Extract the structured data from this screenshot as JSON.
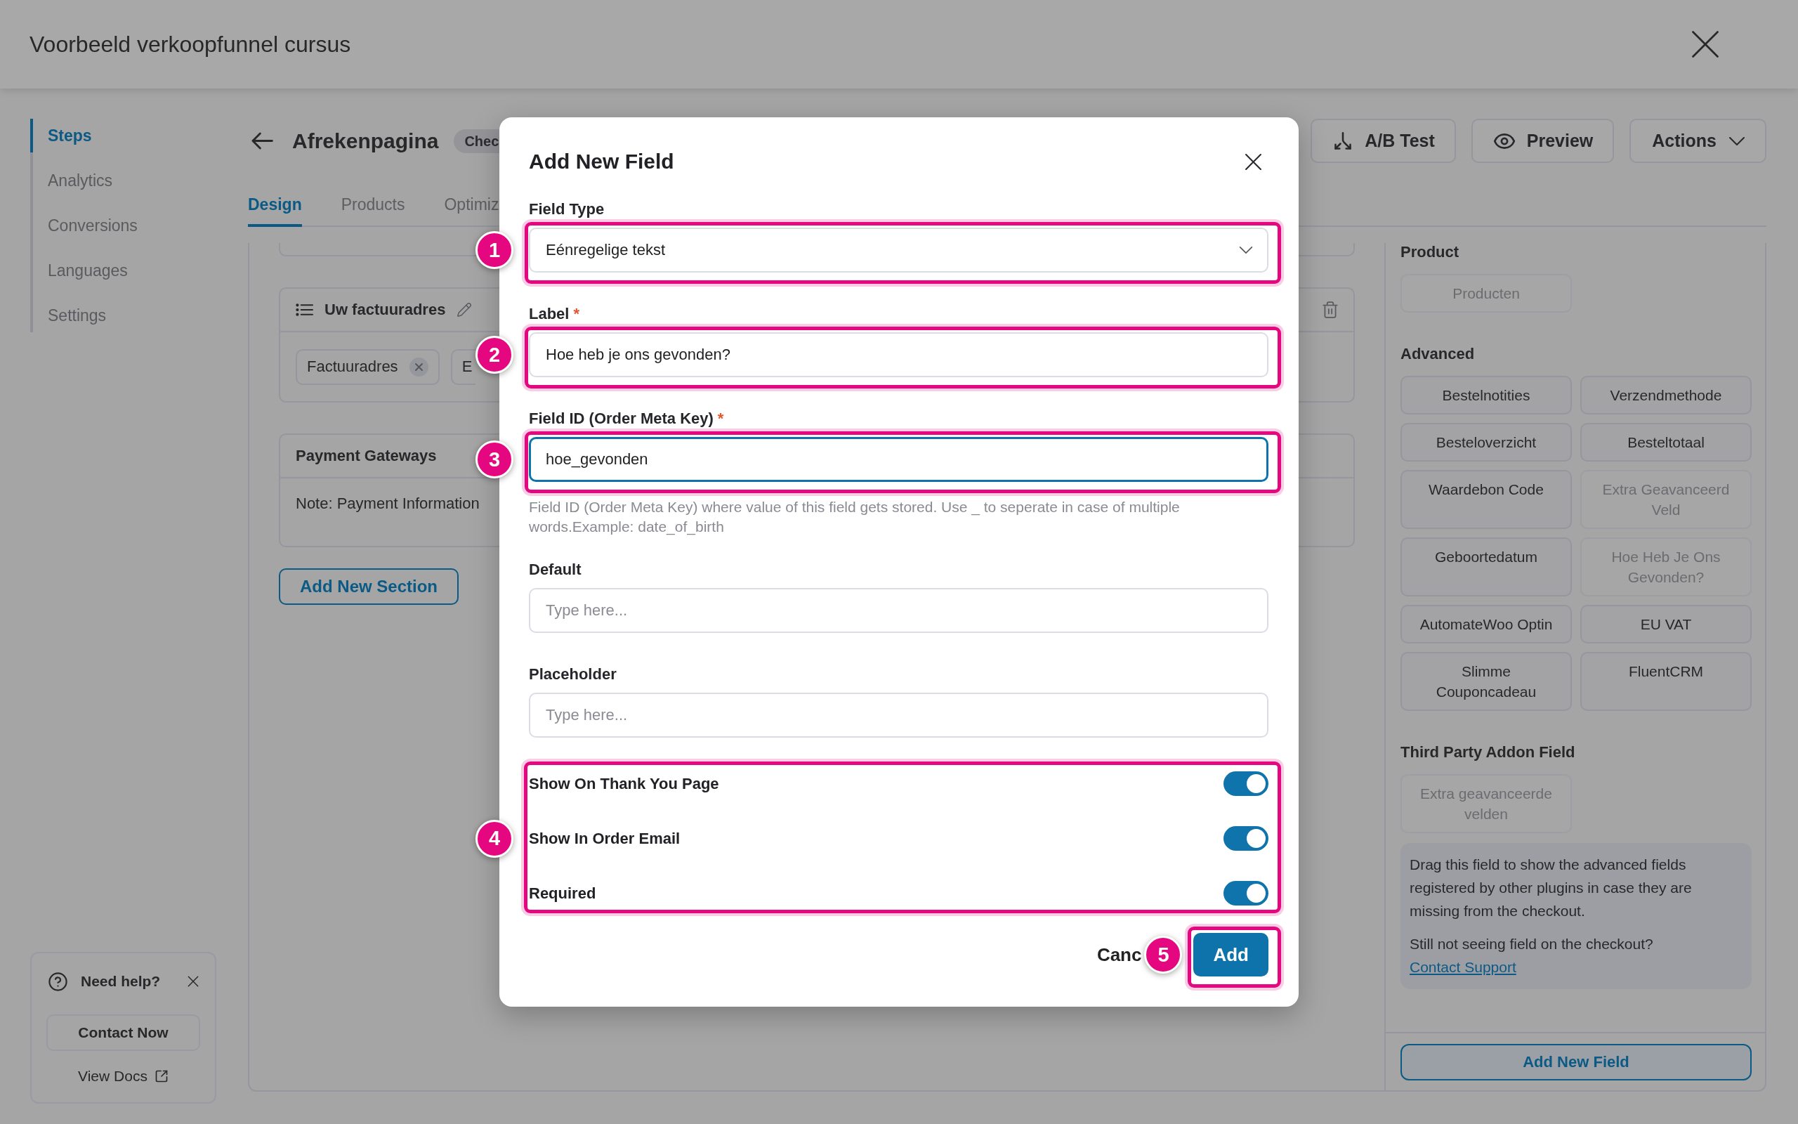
{
  "header": {
    "title": "Voorbeeld verkoopfunnel cursus"
  },
  "sidebar": {
    "items": [
      {
        "label": "Steps",
        "selected": true
      },
      {
        "label": "Analytics",
        "selected": false
      },
      {
        "label": "Conversions",
        "selected": false
      },
      {
        "label": "Languages",
        "selected": false
      },
      {
        "label": "Settings",
        "selected": false
      }
    ],
    "help": {
      "title": "Need help?",
      "button": "Contact Now",
      "link": "View Docs"
    }
  },
  "page_header": {
    "title": "Afrekenpagina",
    "badge": "Chec",
    "buttons": [
      {
        "label": "A/B Test",
        "kind": "split"
      },
      {
        "label": "Preview",
        "kind": "preview"
      },
      {
        "label": "Actions",
        "kind": "menu"
      }
    ]
  },
  "tabs": [
    {
      "label": "Design",
      "selected": true
    },
    {
      "label": "Products",
      "selected": false
    },
    {
      "label": "Optimiz",
      "selected": false
    }
  ],
  "canvas": {
    "sections": [
      {
        "kind": "fields",
        "title": "Uw factuuradres",
        "chips": [
          {
            "label": "Factuuradres",
            "removable": true
          },
          {
            "label": "E",
            "removable": false
          }
        ]
      },
      {
        "kind": "note",
        "title": "Payment Gateways",
        "note": "Note: Payment Information"
      }
    ],
    "add_button": "Add New Section"
  },
  "field_panel": {
    "groups": [
      {
        "title": "Product",
        "items": [
          {
            "label": "Producten",
            "disabled": true
          }
        ]
      },
      {
        "title": "Advanced",
        "items": [
          {
            "label": "Bestelnotities",
            "disabled": false
          },
          {
            "label": "Verzendmethode",
            "disabled": false
          },
          {
            "label": "Besteloverzicht",
            "disabled": false
          },
          {
            "label": "Besteltotaal",
            "disabled": false
          },
          {
            "label": "Waardebon Code",
            "disabled": false
          },
          {
            "label": "Extra Geavanceerd Veld",
            "disabled": true
          },
          {
            "label": "Geboortedatum",
            "disabled": false
          },
          {
            "label": "Hoe Heb Je Ons Gevonden?",
            "disabled": true
          },
          {
            "label": "AutomateWoo Optin",
            "disabled": false
          },
          {
            "label": "EU VAT",
            "disabled": false
          },
          {
            "label": "Slimme Couponcadeau",
            "disabled": false
          },
          {
            "label": "FluentCRM",
            "disabled": false
          }
        ]
      },
      {
        "title": "Third Party Addon Field",
        "items": [
          {
            "label": "Extra geavanceerde velden",
            "disabled": true
          }
        ]
      }
    ],
    "info": {
      "text": "Drag this field to show the advanced fields registered by other plugins in case they are missing from the checkout.",
      "question": "Still not seeing field on the checkout?",
      "link": "Contact Support"
    },
    "add_button": "Add New Field"
  },
  "modal": {
    "title": "Add New Field",
    "fields": [
      {
        "kind": "select",
        "label": "Field Type",
        "value": "Eénregelige tekst",
        "focused": false,
        "annotation": "1"
      },
      {
        "kind": "text",
        "label": "Label",
        "required_mark": "*",
        "value": "Hoe heb je ons gevonden?",
        "focused": false,
        "annotation": "2"
      },
      {
        "kind": "text",
        "label": "Field ID (Order Meta Key)",
        "required_mark": "*",
        "value": "hoe_gevonden",
        "focused": true,
        "annotation": "3",
        "help": "Field ID (Order Meta Key) where value of this field gets stored. Use _ to seperate in case of multiple words.Example: date_of_birth"
      },
      {
        "kind": "text",
        "label": "Default",
        "placeholder": "Type here...",
        "focused": false
      },
      {
        "kind": "text",
        "label": "Placeholder",
        "placeholder": "Type here...",
        "focused": false
      }
    ],
    "toggles": {
      "annotation": "4",
      "items": [
        {
          "label": "Show On Thank You Page",
          "on": true
        },
        {
          "label": "Show In Order Email",
          "on": true
        },
        {
          "label": "Required",
          "on": true
        }
      ]
    },
    "cancel": "Canc",
    "submit": {
      "label": "Add",
      "annotation": "5"
    }
  }
}
